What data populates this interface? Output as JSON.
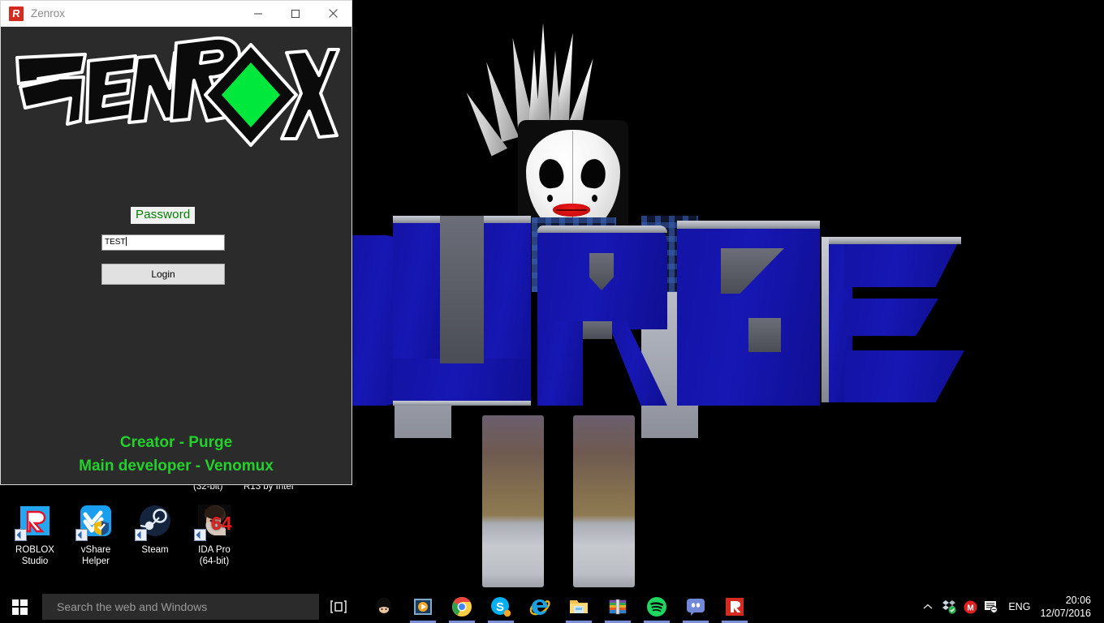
{
  "window": {
    "title": "Zenrox",
    "icon": "roblox-icon",
    "controls": {
      "minimize": "minimize",
      "maximize": "maximize",
      "close": "close"
    },
    "logo_text": "ZENROX",
    "logo_accent_color": "#00e83c",
    "password_label": "Password",
    "password_value": "TEST",
    "password_placeholder": "",
    "login_label": "Login",
    "credit_line_1": "Creator - Purge",
    "credit_line_2": "Main developer - Venomux",
    "credit_color": "#22d12a",
    "background_color": "#2b2b2b"
  },
  "desktop": {
    "wallpaper_text": "PURGE",
    "wallpaper_letter_color": "#1414ab",
    "icons": [
      {
        "name": "roblox-studio",
        "label_line_1": "ROBLOX",
        "label_line_2": "Studio"
      },
      {
        "name": "vshare-helper",
        "label_line_1": "vShare",
        "label_line_2": "Helper"
      },
      {
        "name": "steam",
        "label_line_1": "Steam",
        "label_line_2": ""
      },
      {
        "name": "ida-pro",
        "label_line_1": "IDA Pro",
        "label_line_2": "(64-bit)"
      }
    ],
    "occluded_labels": [
      {
        "text": "(32-bit)"
      },
      {
        "text": "R13 by Intel"
      }
    ]
  },
  "taskbar": {
    "start_label": "Start",
    "search_placeholder": "Search the web and Windows",
    "task_view_label": "Task View",
    "pinned": [
      {
        "name": "goku",
        "label": "Goku",
        "active": false
      },
      {
        "name": "media-player",
        "label": "Media Player",
        "active": true
      },
      {
        "name": "chrome",
        "label": "Google Chrome",
        "active": true
      },
      {
        "name": "skype",
        "label": "Skype",
        "active": true
      },
      {
        "name": "internet-explorer",
        "label": "Internet Explorer",
        "active": false
      },
      {
        "name": "file-explorer",
        "label": "File Explorer",
        "active": true
      },
      {
        "name": "winrar",
        "label": "WinRAR",
        "active": true
      },
      {
        "name": "spotify",
        "label": "Spotify",
        "active": true
      },
      {
        "name": "discord",
        "label": "Discord",
        "active": true
      },
      {
        "name": "roblox",
        "label": "Roblox",
        "active": true
      }
    ],
    "tray": {
      "show_hidden_label": "Show hidden icons",
      "dropbox_label": "Dropbox",
      "mail_label": "Mail",
      "action_center_label": "Action Center",
      "language": "ENG",
      "time": "20:06",
      "date": "12/07/2016"
    }
  }
}
